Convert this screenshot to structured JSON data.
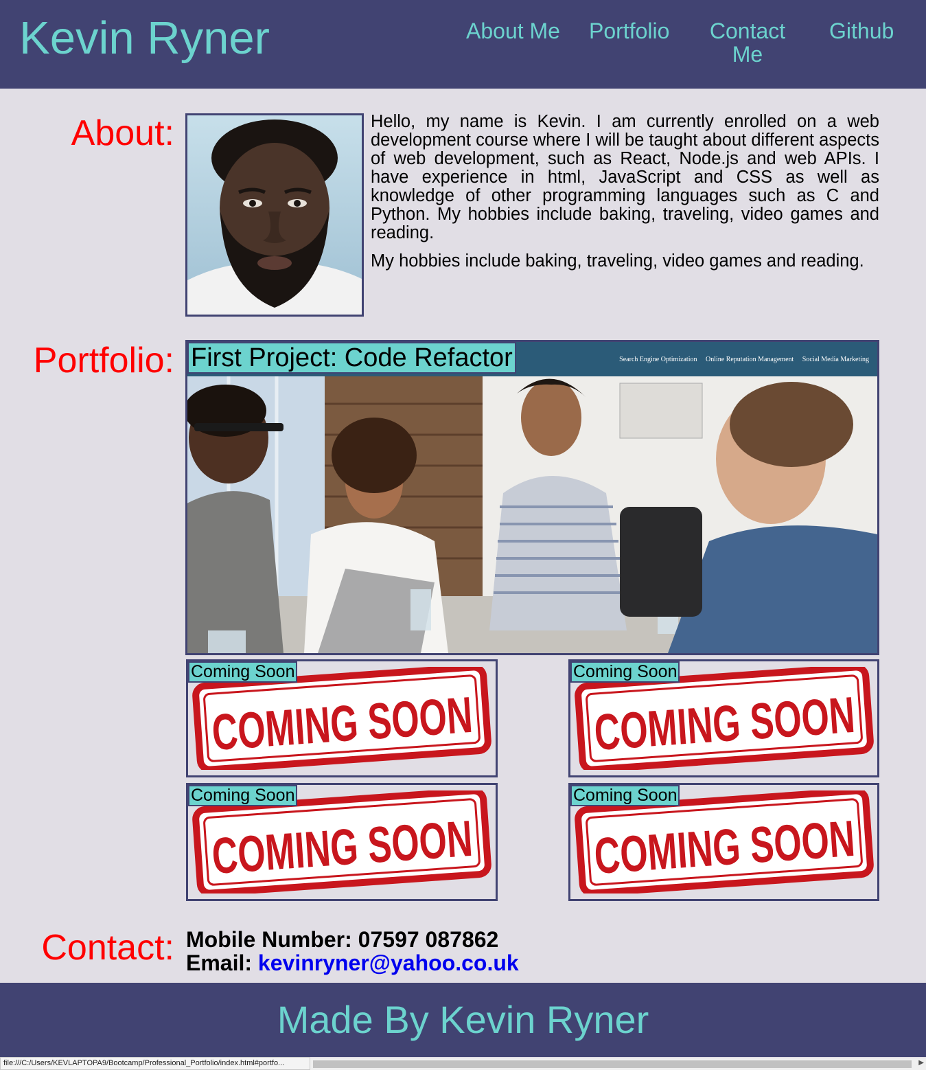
{
  "header": {
    "site_title": "Kevin Ryner",
    "nav": {
      "about": "About Me",
      "portfolio": "Portfolio",
      "contact_line1": "Contact",
      "contact_line2": "Me",
      "github": "Github"
    }
  },
  "about": {
    "label": "About:",
    "paragraph1": "Hello, my name is Kevin. I am currently enrolled on a web development course where I will be taught about different aspects of web development, such as React, Node.js and web APIs. I have experience in html, JavaScript and CSS as well as knowledge of other programming languages such as C and Python. My hobbies include baking, traveling, video games and reading.",
    "paragraph2": "My hobbies include baking, traveling, video games and reading."
  },
  "portfolio": {
    "label": "Portfolio:",
    "featured": {
      "title": "First Project: Code Refactor",
      "screenshot_nav": [
        "Search Engine Optimization",
        "Online Reputation Management",
        "Social Media Marketing"
      ]
    },
    "placeholders": [
      {
        "title": "Coming Soon",
        "stamp_text": "COMING SOON"
      },
      {
        "title": "Coming Soon",
        "stamp_text": "COMING SOON"
      },
      {
        "title": "Coming Soon",
        "stamp_text": "COMING SOON"
      },
      {
        "title": "Coming Soon",
        "stamp_text": "COMING SOON"
      }
    ]
  },
  "contact": {
    "label": "Contact:",
    "mobile_label": "Mobile Number:",
    "mobile_value": "07597 087862",
    "email_label": "Email:",
    "email_value": "kevinryner@yahoo.co.uk"
  },
  "footer": {
    "text": "Made By Kevin Ryner"
  },
  "browser": {
    "status_url": "file:///C:/Users/KEVLAPTOPA9/Bootcamp/Professional_Portfolio/index.html#portfo..."
  },
  "colors": {
    "header_bg": "#414372",
    "accent_teal": "#6cd3ce",
    "page_bg": "#e1dee5",
    "section_label": "#ff0000",
    "stamp_red": "#c8161d",
    "link_blue": "#0000ee"
  }
}
